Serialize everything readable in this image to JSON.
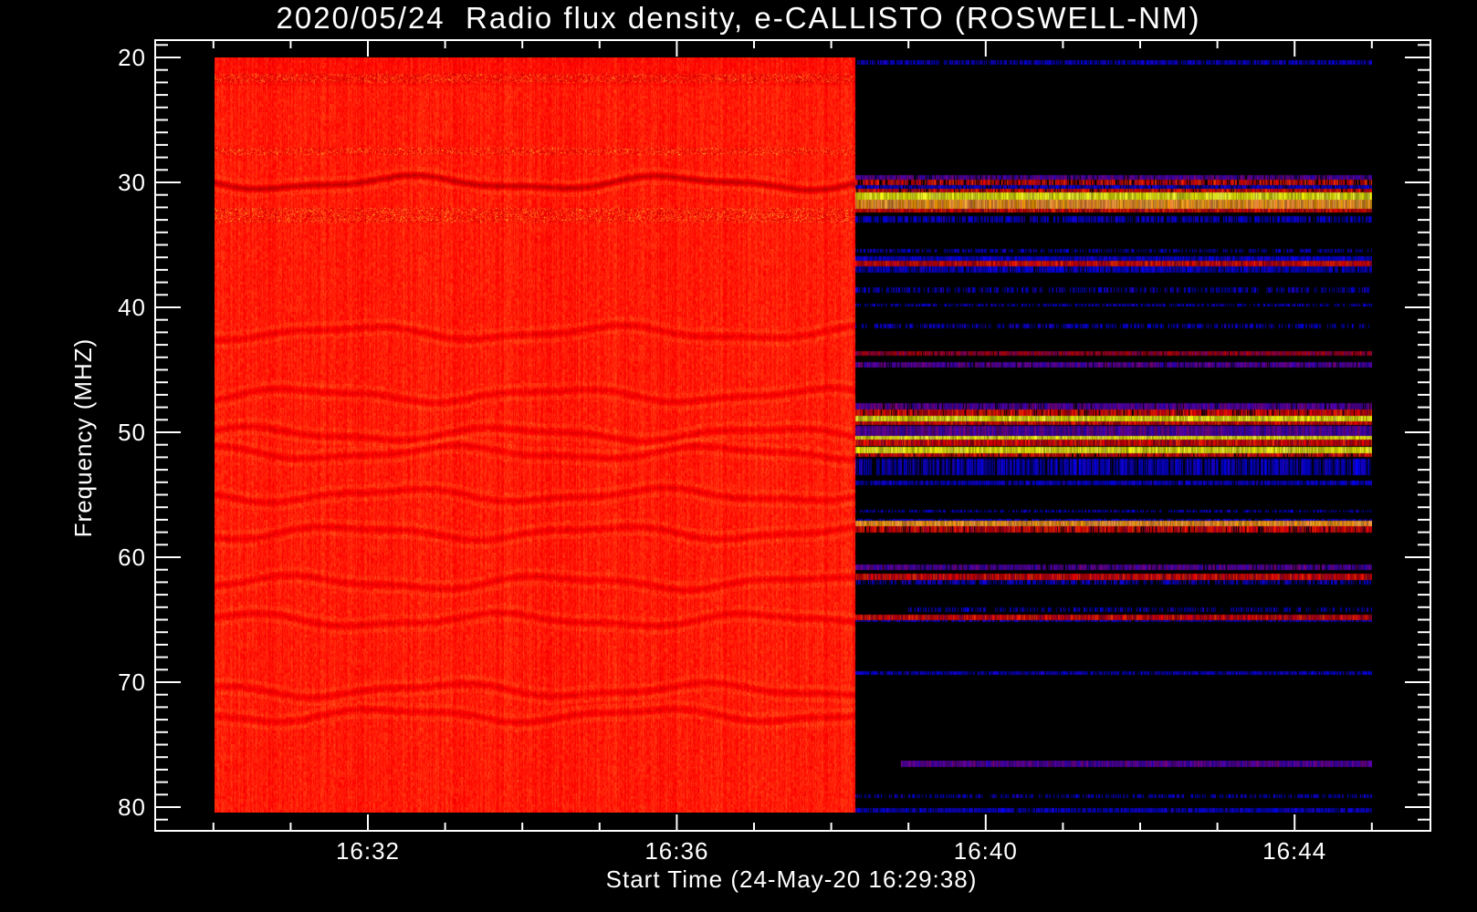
{
  "chart_data": {
    "type": "heatmap",
    "title": "2020/05/24  Radio flux density, e-CALLISTO (ROSWELL-NM)",
    "xlabel": "Start Time (24-May-20 16:29:38)",
    "ylabel": "Frequency (MHZ)",
    "x_unit": "minutes after 16:00 UT",
    "xlim": [
      30.0,
      45.0
    ],
    "x_ticks": [
      {
        "value": 32,
        "label": "16:32"
      },
      {
        "value": 36,
        "label": "16:36"
      },
      {
        "value": 40,
        "label": "16:40"
      },
      {
        "value": 44,
        "label": "16:44"
      }
    ],
    "x_minor_step": 1,
    "ylim": [
      20,
      80.5
    ],
    "y_inverted": true,
    "y_ticks": [
      {
        "value": 20,
        "label": "20"
      },
      {
        "value": 30,
        "label": "30"
      },
      {
        "value": 40,
        "label": "40"
      },
      {
        "value": 50,
        "label": "50"
      },
      {
        "value": 60,
        "label": "60"
      },
      {
        "value": 70,
        "label": "70"
      },
      {
        "value": 80,
        "label": "80"
      }
    ],
    "y_minor_step": 1,
    "grid": false,
    "segments": [
      {
        "name": "active-background",
        "t_start": 30.0,
        "t_end": 38.31,
        "colormap": "red-orange"
      },
      {
        "name": "rfi-only",
        "t_start": 38.31,
        "t_end": 45.0,
        "colormap": "black-blue-red-yellow"
      }
    ],
    "active_features": {
      "dark_wavy_bands_mhz": [
        30.0,
        42.0,
        47.0,
        50.1,
        51.6,
        55.0,
        58.0,
        62.0,
        65.0,
        70.6,
        72.6
      ],
      "interference_rows_mhz": [
        [
          21.3,
          22.0
        ],
        [
          27.2,
          27.8
        ],
        [
          32.0,
          33.2
        ]
      ]
    },
    "rfi_bands": [
      {
        "f": [
          20.2,
          20.6
        ],
        "level": "blue",
        "fill": 0.8
      },
      {
        "f": [
          29.4,
          29.8
        ],
        "level": "purple",
        "fill": 0.9
      },
      {
        "f": [
          29.8,
          30.2
        ],
        "level": "red",
        "fill": 0.8
      },
      {
        "f": [
          30.2,
          30.5
        ],
        "level": "blue",
        "fill": 0.9
      },
      {
        "f": [
          30.5,
          30.8
        ],
        "level": "red",
        "fill": 0.9
      },
      {
        "f": [
          30.8,
          31.4
        ],
        "level": "yellow",
        "fill": 1
      },
      {
        "f": [
          31.4,
          32.1
        ],
        "level": "orange",
        "fill": 1
      },
      {
        "f": [
          32.1,
          32.4
        ],
        "level": "red",
        "fill": 1
      },
      {
        "f": [
          32.7,
          33.2
        ],
        "level": "blue",
        "fill": 0.7
      },
      {
        "f": [
          35.3,
          35.6
        ],
        "level": "blue",
        "fill": 0.5
      },
      {
        "f": [
          35.9,
          36.3
        ],
        "level": "blue",
        "fill": 1
      },
      {
        "f": [
          36.3,
          36.7
        ],
        "level": "red",
        "fill": 1
      },
      {
        "f": [
          36.7,
          37.2
        ],
        "level": "blue",
        "fill": 0.9
      },
      {
        "f": [
          38.4,
          38.8
        ],
        "level": "blue",
        "fill": 0.5
      },
      {
        "f": [
          39.7,
          39.9
        ],
        "level": "blue",
        "fill": 0.6
      },
      {
        "f": [
          41.3,
          41.7
        ],
        "level": "blue",
        "fill": 0.5
      },
      {
        "f": [
          43.5,
          43.9
        ],
        "level": "darkred",
        "fill": 0.95
      },
      {
        "f": [
          44.4,
          44.8
        ],
        "level": "purple",
        "fill": 0.9
      },
      {
        "f": [
          47.7,
          48.2
        ],
        "level": "purple",
        "fill": 0.9
      },
      {
        "f": [
          48.2,
          48.7
        ],
        "level": "red",
        "fill": 0.9
      },
      {
        "f": [
          48.7,
          49.1
        ],
        "level": "yellow",
        "fill": 1
      },
      {
        "f": [
          49.1,
          49.4
        ],
        "level": "red",
        "fill": 1
      },
      {
        "f": [
          49.5,
          50.3
        ],
        "level": "purple",
        "fill": 1
      },
      {
        "f": [
          50.3,
          50.6
        ],
        "level": "yellow",
        "fill": 1
      },
      {
        "f": [
          50.6,
          51.1
        ],
        "level": "red",
        "fill": 1
      },
      {
        "f": [
          51.2,
          51.7
        ],
        "level": "yellow",
        "fill": 1
      },
      {
        "f": [
          51.7,
          52.0
        ],
        "level": "red",
        "fill": 0.9
      },
      {
        "f": [
          52.1,
          53.4
        ],
        "level": "blue",
        "fill": 0.8
      },
      {
        "f": [
          53.9,
          54.2
        ],
        "level": "blue",
        "fill": 0.9
      },
      {
        "f": [
          56.2,
          56.4
        ],
        "level": "blue",
        "fill": 0.5
      },
      {
        "f": [
          56.9,
          57.1
        ],
        "level": "blue",
        "fill": 0.8
      },
      {
        "f": [
          57.1,
          57.5
        ],
        "level": "orange",
        "fill": 1
      },
      {
        "f": [
          57.5,
          58.0
        ],
        "level": "red",
        "fill": 0.9
      },
      {
        "f": [
          60.6,
          61.0
        ],
        "level": "purple",
        "fill": 0.9
      },
      {
        "f": [
          61.3,
          61.8
        ],
        "level": "red",
        "fill": 1
      },
      {
        "f": [
          61.8,
          62.2
        ],
        "level": "blue",
        "fill": 0.6
      },
      {
        "f": [
          64.0,
          64.4
        ],
        "level": "blue",
        "fill": 0.4,
        "t_start": 39.0
      },
      {
        "f": [
          64.6,
          65.0
        ],
        "level": "red",
        "fill": 1
      },
      {
        "f": [
          65.0,
          65.2
        ],
        "level": "blue",
        "fill": 0.8
      },
      {
        "f": [
          69.1,
          69.4
        ],
        "level": "blue",
        "fill": 0.8
      },
      {
        "f": [
          76.3,
          76.8
        ],
        "level": "purple",
        "fill": 1,
        "t_start": 38.9
      },
      {
        "f": [
          79.0,
          79.3
        ],
        "level": "blue",
        "fill": 0.5
      },
      {
        "f": [
          80.1,
          80.5
        ],
        "level": "blue",
        "fill": 0.9
      }
    ],
    "palettes": {
      "blue": [
        "#0000ff",
        "#0000c8",
        "#00008c",
        "#2000e0"
      ],
      "purple": [
        "#5000a0",
        "#6000b4",
        "#3000c8",
        "#800080"
      ],
      "red": [
        "#ff0000",
        "#c80000",
        "#ff3000",
        "#a00030"
      ],
      "darkred": [
        "#a00020",
        "#800060",
        "#c00000"
      ],
      "yellow": [
        "#ffff40",
        "#ffff00",
        "#e0e000"
      ],
      "orange": [
        "#ffa000",
        "#ff9040",
        "#ffb040"
      ]
    }
  }
}
